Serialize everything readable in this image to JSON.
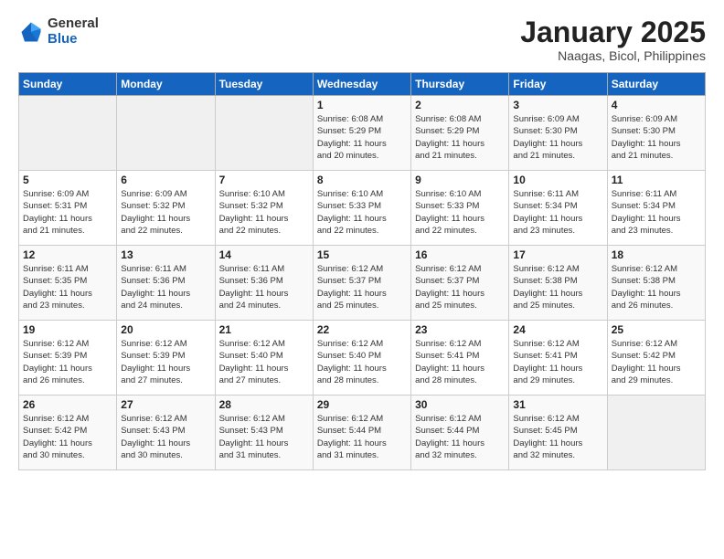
{
  "logo": {
    "general": "General",
    "blue": "Blue"
  },
  "header": {
    "title": "January 2025",
    "location": "Naagas, Bicol, Philippines"
  },
  "weekdays": [
    "Sunday",
    "Monday",
    "Tuesday",
    "Wednesday",
    "Thursday",
    "Friday",
    "Saturday"
  ],
  "weeks": [
    [
      {
        "day": "",
        "content": ""
      },
      {
        "day": "",
        "content": ""
      },
      {
        "day": "",
        "content": ""
      },
      {
        "day": "1",
        "content": "Sunrise: 6:08 AM\nSunset: 5:29 PM\nDaylight: 11 hours\nand 20 minutes."
      },
      {
        "day": "2",
        "content": "Sunrise: 6:08 AM\nSunset: 5:29 PM\nDaylight: 11 hours\nand 21 minutes."
      },
      {
        "day": "3",
        "content": "Sunrise: 6:09 AM\nSunset: 5:30 PM\nDaylight: 11 hours\nand 21 minutes."
      },
      {
        "day": "4",
        "content": "Sunrise: 6:09 AM\nSunset: 5:30 PM\nDaylight: 11 hours\nand 21 minutes."
      }
    ],
    [
      {
        "day": "5",
        "content": "Sunrise: 6:09 AM\nSunset: 5:31 PM\nDaylight: 11 hours\nand 21 minutes."
      },
      {
        "day": "6",
        "content": "Sunrise: 6:09 AM\nSunset: 5:32 PM\nDaylight: 11 hours\nand 22 minutes."
      },
      {
        "day": "7",
        "content": "Sunrise: 6:10 AM\nSunset: 5:32 PM\nDaylight: 11 hours\nand 22 minutes."
      },
      {
        "day": "8",
        "content": "Sunrise: 6:10 AM\nSunset: 5:33 PM\nDaylight: 11 hours\nand 22 minutes."
      },
      {
        "day": "9",
        "content": "Sunrise: 6:10 AM\nSunset: 5:33 PM\nDaylight: 11 hours\nand 22 minutes."
      },
      {
        "day": "10",
        "content": "Sunrise: 6:11 AM\nSunset: 5:34 PM\nDaylight: 11 hours\nand 23 minutes."
      },
      {
        "day": "11",
        "content": "Sunrise: 6:11 AM\nSunset: 5:34 PM\nDaylight: 11 hours\nand 23 minutes."
      }
    ],
    [
      {
        "day": "12",
        "content": "Sunrise: 6:11 AM\nSunset: 5:35 PM\nDaylight: 11 hours\nand 23 minutes."
      },
      {
        "day": "13",
        "content": "Sunrise: 6:11 AM\nSunset: 5:36 PM\nDaylight: 11 hours\nand 24 minutes."
      },
      {
        "day": "14",
        "content": "Sunrise: 6:11 AM\nSunset: 5:36 PM\nDaylight: 11 hours\nand 24 minutes."
      },
      {
        "day": "15",
        "content": "Sunrise: 6:12 AM\nSunset: 5:37 PM\nDaylight: 11 hours\nand 25 minutes."
      },
      {
        "day": "16",
        "content": "Sunrise: 6:12 AM\nSunset: 5:37 PM\nDaylight: 11 hours\nand 25 minutes."
      },
      {
        "day": "17",
        "content": "Sunrise: 6:12 AM\nSunset: 5:38 PM\nDaylight: 11 hours\nand 25 minutes."
      },
      {
        "day": "18",
        "content": "Sunrise: 6:12 AM\nSunset: 5:38 PM\nDaylight: 11 hours\nand 26 minutes."
      }
    ],
    [
      {
        "day": "19",
        "content": "Sunrise: 6:12 AM\nSunset: 5:39 PM\nDaylight: 11 hours\nand 26 minutes."
      },
      {
        "day": "20",
        "content": "Sunrise: 6:12 AM\nSunset: 5:39 PM\nDaylight: 11 hours\nand 27 minutes."
      },
      {
        "day": "21",
        "content": "Sunrise: 6:12 AM\nSunset: 5:40 PM\nDaylight: 11 hours\nand 27 minutes."
      },
      {
        "day": "22",
        "content": "Sunrise: 6:12 AM\nSunset: 5:40 PM\nDaylight: 11 hours\nand 28 minutes."
      },
      {
        "day": "23",
        "content": "Sunrise: 6:12 AM\nSunset: 5:41 PM\nDaylight: 11 hours\nand 28 minutes."
      },
      {
        "day": "24",
        "content": "Sunrise: 6:12 AM\nSunset: 5:41 PM\nDaylight: 11 hours\nand 29 minutes."
      },
      {
        "day": "25",
        "content": "Sunrise: 6:12 AM\nSunset: 5:42 PM\nDaylight: 11 hours\nand 29 minutes."
      }
    ],
    [
      {
        "day": "26",
        "content": "Sunrise: 6:12 AM\nSunset: 5:42 PM\nDaylight: 11 hours\nand 30 minutes."
      },
      {
        "day": "27",
        "content": "Sunrise: 6:12 AM\nSunset: 5:43 PM\nDaylight: 11 hours\nand 30 minutes."
      },
      {
        "day": "28",
        "content": "Sunrise: 6:12 AM\nSunset: 5:43 PM\nDaylight: 11 hours\nand 31 minutes."
      },
      {
        "day": "29",
        "content": "Sunrise: 6:12 AM\nSunset: 5:44 PM\nDaylight: 11 hours\nand 31 minutes."
      },
      {
        "day": "30",
        "content": "Sunrise: 6:12 AM\nSunset: 5:44 PM\nDaylight: 11 hours\nand 32 minutes."
      },
      {
        "day": "31",
        "content": "Sunrise: 6:12 AM\nSunset: 5:45 PM\nDaylight: 11 hours\nand 32 minutes."
      },
      {
        "day": "",
        "content": ""
      }
    ]
  ]
}
